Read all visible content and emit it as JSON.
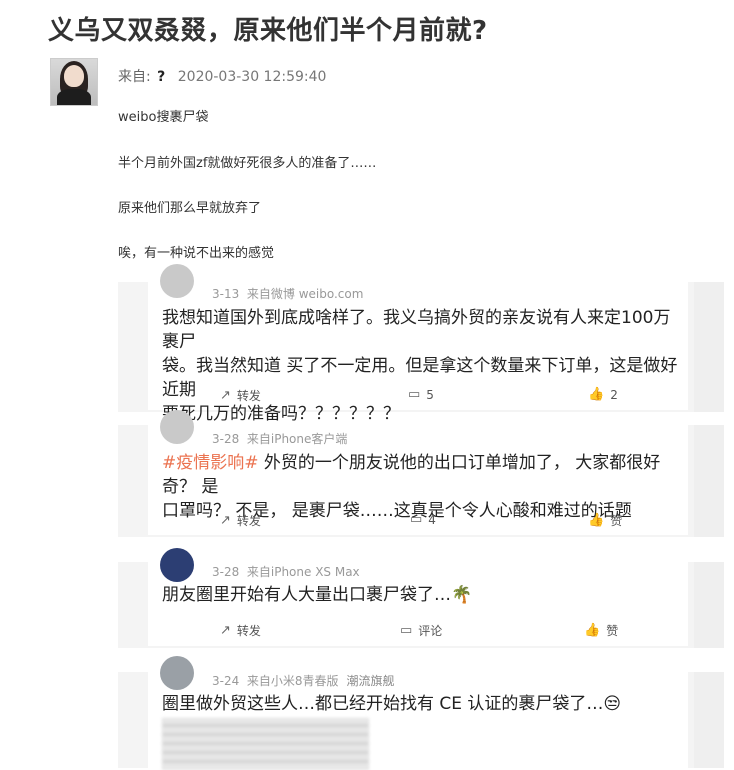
{
  "post": {
    "title": "义乌又双叒叕，原来他们半个月前就?",
    "author_label": "来自:",
    "author_icon": "question-mark-icon",
    "timestamp": "2020-03-30 12:59:40",
    "paragraphs": [
      "weibo搜裹尸袋",
      "半个月前外国zf就做好死很多人的准备了……",
      "原来他们那么早就放弃了",
      "唉，有一种说不出来的感觉"
    ]
  },
  "comments": [
    {
      "date": "3-13",
      "source": "来自微博 weibo.com",
      "tag": "",
      "hashtag": "",
      "lines": [
        "我想知道国外到底成啥样了。我义乌搞外贸的亲友说有人来定100万裹尸",
        "袋。我当然知道 买了不一定用。但是拿这个数量来下订单，这是做好近期",
        "要死几万的准备吗？？？？？？"
      ],
      "actions": {
        "forward": "转发",
        "comment": "5",
        "like": "2"
      }
    },
    {
      "date": "3-28",
      "source": "来自iPhone客户端",
      "tag": "",
      "hashtag": "#疫情影响#",
      "lines": [
        " 外贸的一个朋友说他的出口订单增加了， 大家都很好奇？ 是",
        "口罩吗？ 不是， 是裹尸袋……这真是个令人心酸和难过的话题"
      ],
      "actions": {
        "forward": "转发",
        "comment": "4",
        "like": "赞"
      }
    },
    {
      "date": "3-28",
      "source": "来自iPhone XS Max",
      "tag": "",
      "hashtag": "",
      "lines": [
        "朋友圈里开始有人大量出口裹尸袋了…🌴"
      ],
      "actions": {
        "forward": "转发",
        "comment": "评论",
        "like": "赞"
      }
    },
    {
      "date": "3-24",
      "source": "来自小米8青春版",
      "tag": "潮流旗舰",
      "hashtag": "",
      "lines": [
        "圈里做外贸这些人…都已经开始找有 CE 认证的裹尸袋了…😒"
      ],
      "actions": {}
    }
  ],
  "colors": {
    "hashtag": "#eb7350",
    "muted": "#999999",
    "title": "#333333"
  }
}
